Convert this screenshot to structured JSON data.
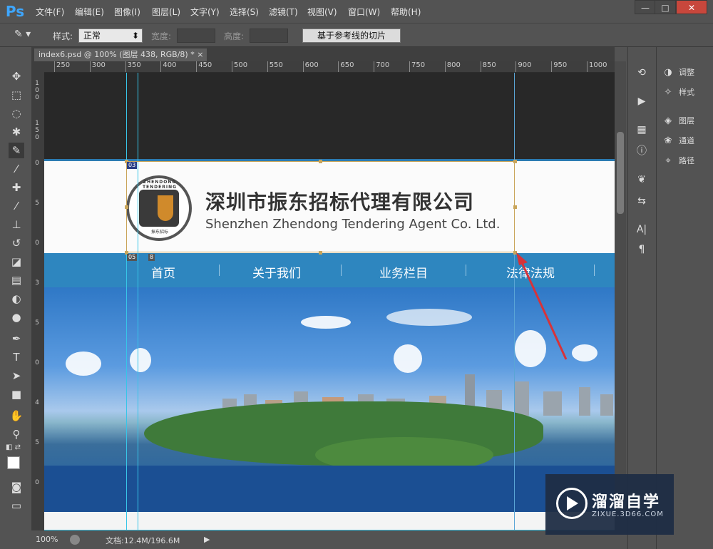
{
  "app": {
    "logo": "Ps"
  },
  "menu": [
    "文件(F)",
    "编辑(E)",
    "图像(I)",
    "图层(L)",
    "文字(Y)",
    "选择(S)",
    "滤镜(T)",
    "视图(V)",
    "窗口(W)",
    "帮助(H)"
  ],
  "window_controls": {
    "minimize": "—",
    "maximize": "□",
    "close": "✕"
  },
  "options": {
    "style_label": "样式:",
    "style_value": "正常",
    "width_label": "宽度:",
    "height_label": "高度:",
    "slice_button": "基于参考线的切片"
  },
  "document": {
    "tab_title": "index6.psd @ 100% (图层 438, RGB/8) *",
    "tab_close": "×"
  },
  "ruler_top": [
    "250",
    "300",
    "350",
    "400",
    "450",
    "500",
    "550",
    "600",
    "650",
    "700",
    "750",
    "800",
    "850",
    "900",
    "950",
    "1000"
  ],
  "ruler_left": [
    {
      "label": "100"
    },
    {
      "label": "150"
    },
    {
      "label": "0"
    },
    {
      "label": "5"
    },
    {
      "label": "0"
    },
    {
      "label": "3"
    },
    {
      "label": "5"
    },
    {
      "label": "0"
    },
    {
      "label": "4"
    },
    {
      "label": "5"
    },
    {
      "label": "0"
    }
  ],
  "page": {
    "company_cn": "深圳市振东招标代理有限公司",
    "company_en": "Shenzhen Zhendong Tendering Agent Co. Ltd.",
    "logo_ring": "ZHENDONG TENDERING",
    "logo_bottom": "振东招标",
    "nav": [
      "首页",
      "关于我们",
      "业务栏目",
      "法律法规"
    ]
  },
  "slice_tags": [
    "03",
    "05",
    "8"
  ],
  "status": {
    "zoom": "100%",
    "doc": "文档:12.4M/196.6M"
  },
  "right_panel": {
    "items": [
      {
        "icon": "adjust-icon",
        "label": "调整"
      },
      {
        "icon": "styles-icon",
        "label": "样式"
      },
      {
        "icon": "layers-icon",
        "label": "图层"
      },
      {
        "icon": "channels-icon",
        "label": "通道"
      },
      {
        "icon": "paths-icon",
        "label": "路径"
      }
    ]
  },
  "watermark": {
    "title": "溜溜自学",
    "url": "ZIXUE.3D66.COM"
  }
}
